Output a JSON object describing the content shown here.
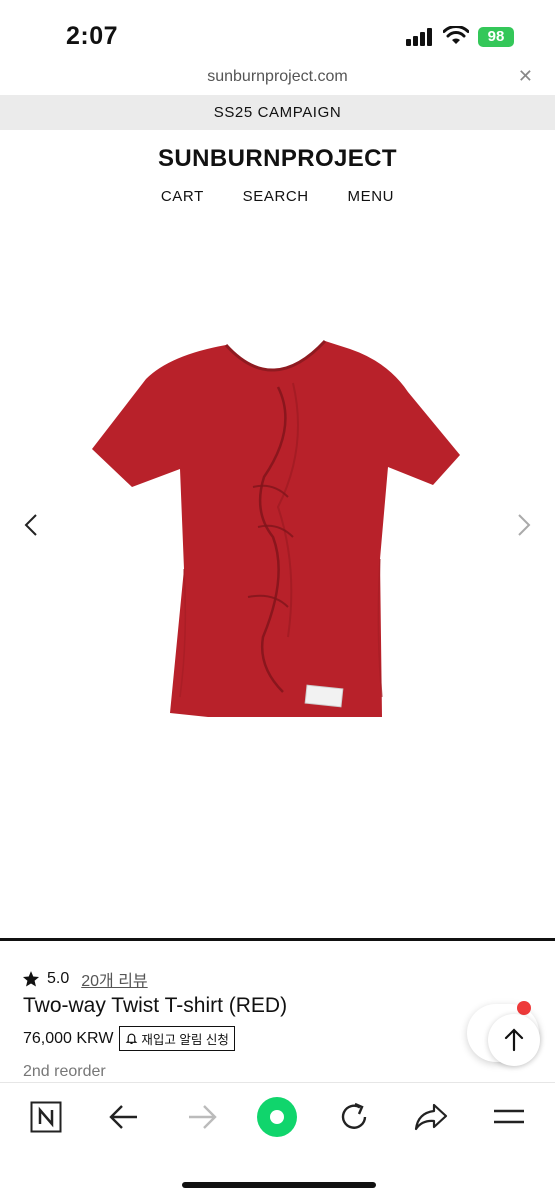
{
  "status": {
    "time": "2:07",
    "battery": "98"
  },
  "browser": {
    "url": "sunburnproject.com"
  },
  "site": {
    "banner": "SS25 CAMPAIGN",
    "logo": "SUNBURNPROJECT",
    "nav": [
      "CART",
      "SEARCH",
      "MENU"
    ]
  },
  "product": {
    "rating": "5.0",
    "reviews": "20개 리뷰",
    "name": "Two-way Twist T-shirt (RED)",
    "price": "76,000 KRW",
    "notify": "재입고 알림 신청",
    "note": "2nd reorder",
    "color": "#b8212a"
  },
  "toolbar": {
    "items": [
      "naver-icon",
      "back-icon",
      "forward-icon",
      "green-dot-icon",
      "reload-icon",
      "share-icon",
      "menu-icon"
    ]
  }
}
